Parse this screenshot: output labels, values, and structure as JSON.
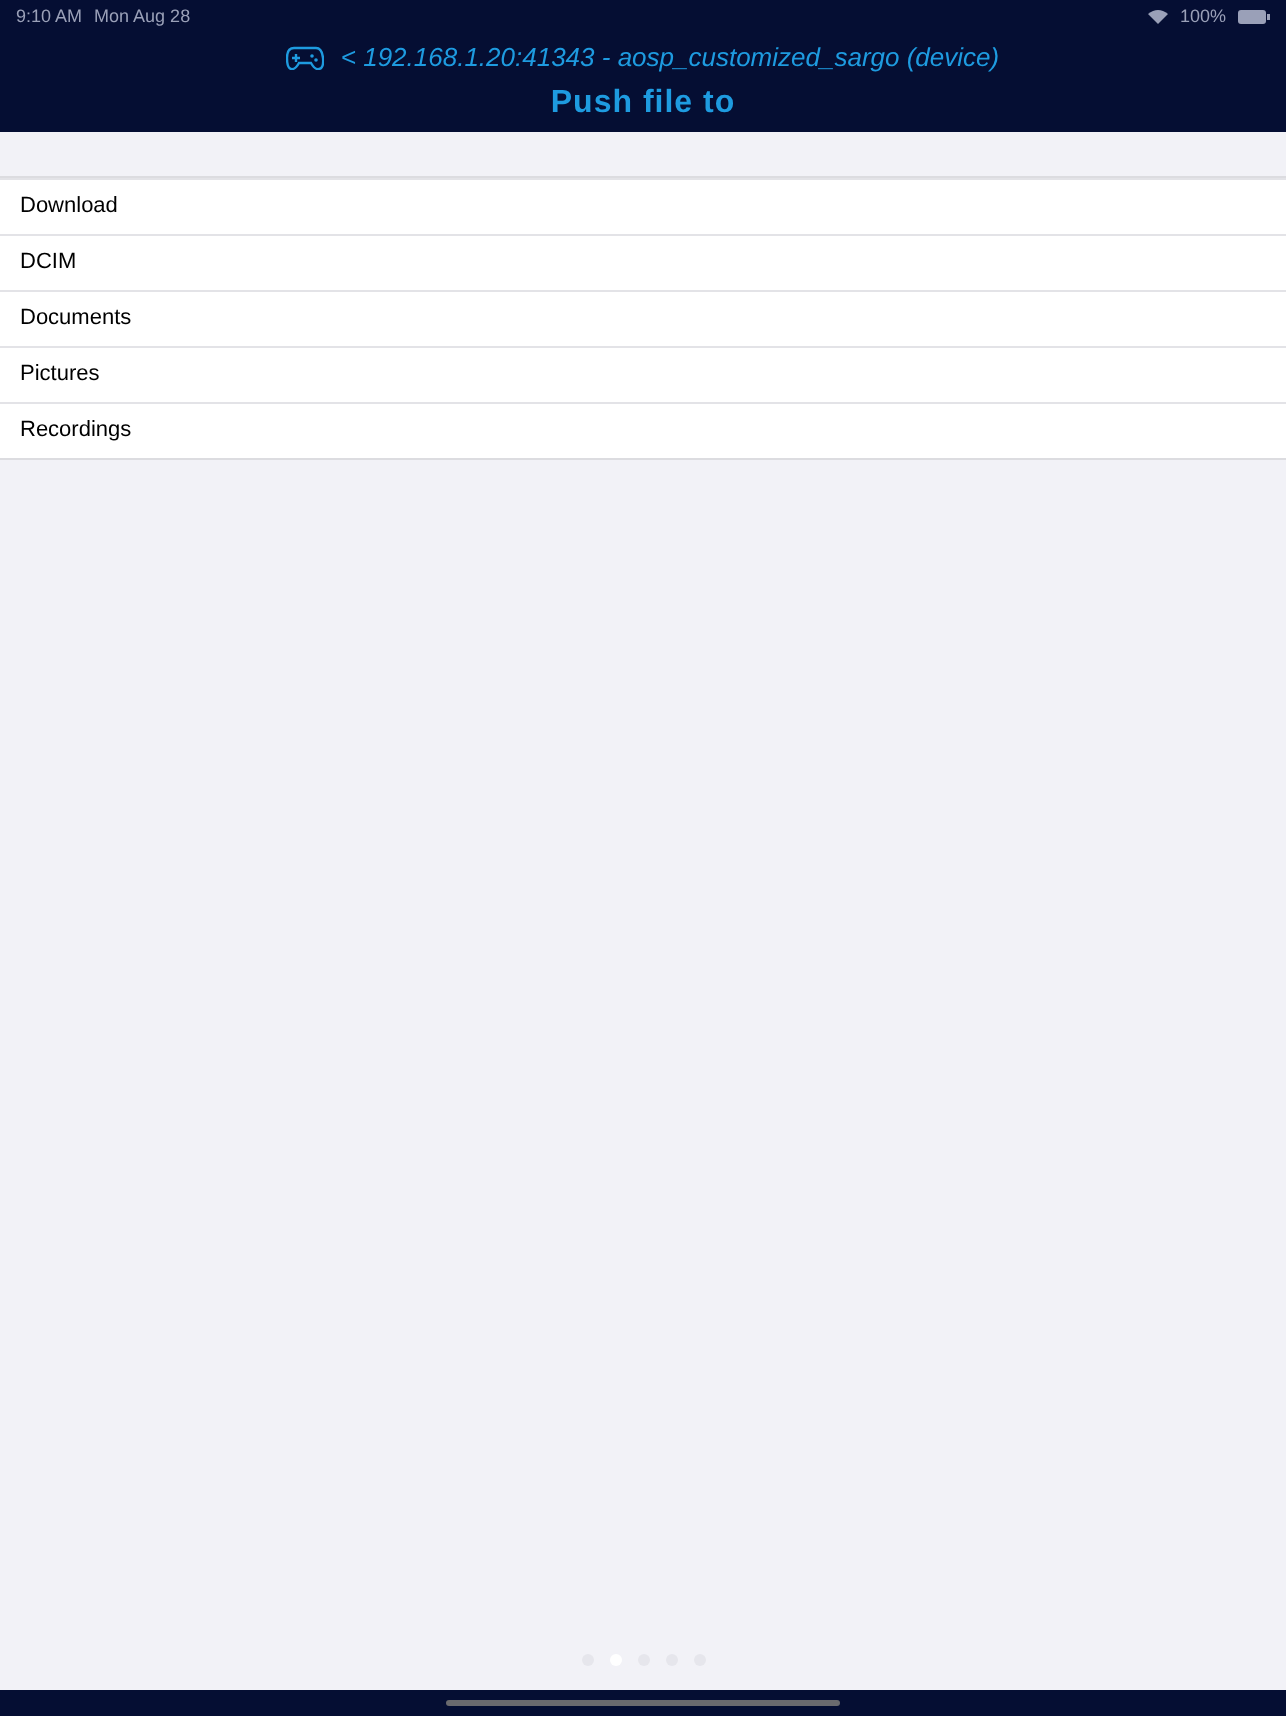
{
  "status_bar": {
    "time": "9:10 AM",
    "date": "Mon Aug 28",
    "battery": "100%"
  },
  "header": {
    "device": "< 192.168.1.20:41343 - aosp_customized_sargo (device)",
    "title": "Push file to"
  },
  "folders": [
    {
      "name": "Download"
    },
    {
      "name": "DCIM"
    },
    {
      "name": "Documents"
    },
    {
      "name": "Pictures"
    },
    {
      "name": "Recordings"
    }
  ],
  "pages": [
    {
      "selected": false
    },
    {
      "selected": true
    },
    {
      "selected": false
    },
    {
      "selected": false
    },
    {
      "selected": false
    }
  ]
}
